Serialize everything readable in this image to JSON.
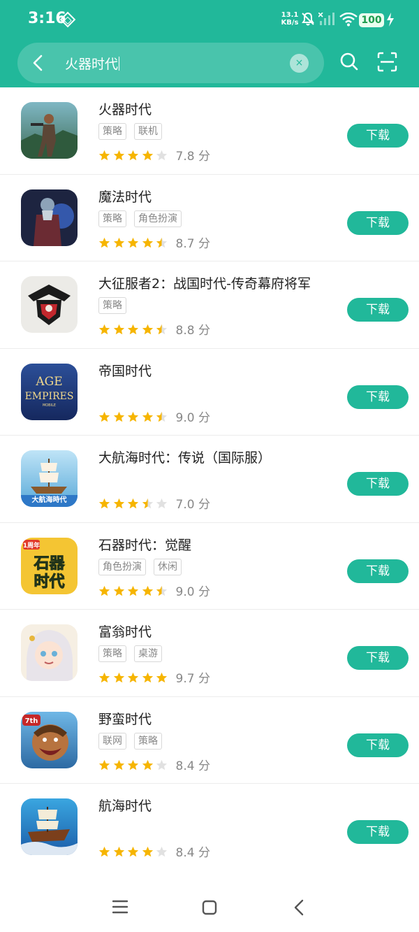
{
  "status_bar": {
    "time": "3:16",
    "net_speed_value": "13.1",
    "net_speed_unit": "KB/s",
    "battery": "100"
  },
  "search": {
    "query": "火器时代",
    "clear_icon": "×"
  },
  "colors": {
    "accent": "#21b89a",
    "star": "#f6b500",
    "star_empty": "#e1e1e1"
  },
  "apps": [
    {
      "name": "火器时代",
      "tags": [
        "策略",
        "联机"
      ],
      "stars": 4,
      "score": "7.8 分",
      "button": "下载"
    },
    {
      "name": "魔法时代",
      "tags": [
        "策略",
        "角色扮演"
      ],
      "stars": 4.5,
      "score": "8.7 分",
      "button": "下载"
    },
    {
      "name": "大征服者2：战国时代-传奇幕府将军",
      "tags": [
        "策略"
      ],
      "stars": 4.5,
      "score": "8.8 分",
      "button": "下载"
    },
    {
      "name": "帝国时代",
      "tags": [],
      "stars": 4.5,
      "score": "9.0 分",
      "button": "下载",
      "icon_text_1": "AGE",
      "icon_text_2": "EMPIRES",
      "icon_text_3": "MOBILE"
    },
    {
      "name": "大航海时代：传说（国际服）",
      "tags": [],
      "stars": 3.5,
      "score": "7.0 分",
      "button": "下载",
      "icon_text_1": "大航海時代"
    },
    {
      "name": "石器时代：觉醒",
      "tags": [
        "角色扮演",
        "休闲"
      ],
      "stars": 4.5,
      "score": "9.0 分",
      "button": "下载",
      "icon_text_1": "1周年",
      "icon_text_2": "石器",
      "icon_text_3": "时代"
    },
    {
      "name": "富翁时代",
      "tags": [
        "策略",
        "桌游"
      ],
      "stars": 5,
      "score": "9.7 分",
      "button": "下载"
    },
    {
      "name": "野蛮时代",
      "tags": [
        "联网",
        "策略"
      ],
      "stars": 4,
      "score": "8.4 分",
      "button": "下载",
      "icon_text_1": "7th"
    },
    {
      "name": "航海时代",
      "tags": [],
      "stars": 4,
      "score": "8.4 分",
      "button": "下载"
    }
  ]
}
